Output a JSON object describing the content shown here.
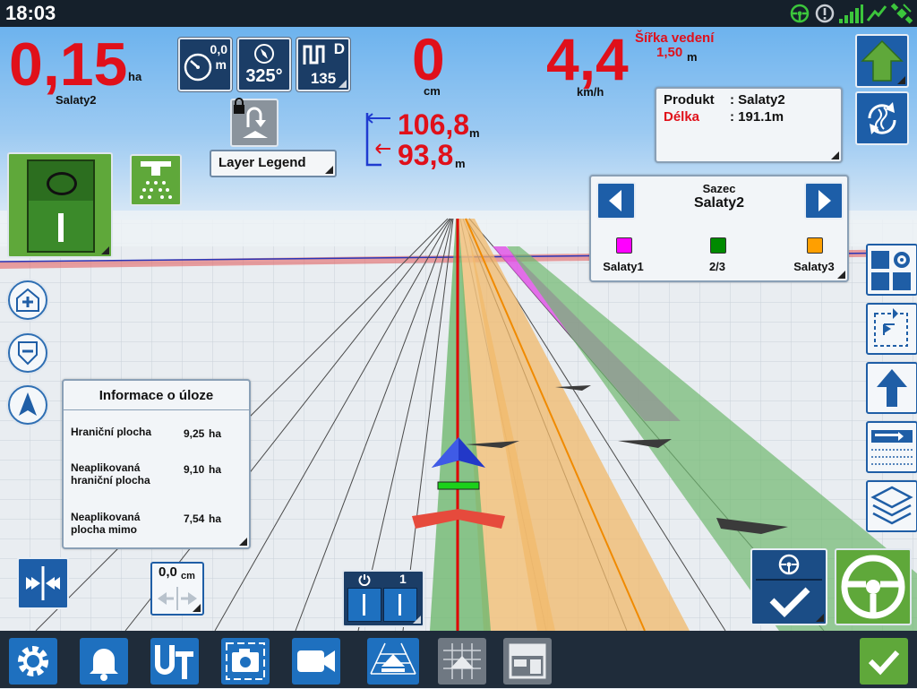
{
  "status": {
    "time": "18:03"
  },
  "area": {
    "value": "0,15",
    "unit": "ha",
    "product": "Salaty2"
  },
  "speedometer_tile": {
    "value": "0,0",
    "unit": "m"
  },
  "heading_tile": {
    "value": "325°"
  },
  "pattern_tile": {
    "letter": "D",
    "value": "135"
  },
  "layer_legend": {
    "label": "Layer Legend"
  },
  "offset": {
    "value": "0",
    "unit": "cm"
  },
  "distances": {
    "top_value": "106,8",
    "top_unit": "m",
    "bottom_value": "93,8",
    "bottom_unit": "m"
  },
  "speed": {
    "value": "4,4",
    "unit": "km/h"
  },
  "guidance_width": {
    "label": "Šířka vedení",
    "value": "1,50",
    "unit": "m"
  },
  "product_panel": {
    "product_label": "Produkt",
    "product_value": ": Salaty2",
    "length_label": "Délka",
    "length_value": ": 191.1m"
  },
  "seeder_panel": {
    "title": "Sazec",
    "selected": "Salaty2",
    "items": [
      {
        "label": "Salaty1",
        "color": "#ff00ff"
      },
      {
        "label": "2/3",
        "color": "#008a00"
      },
      {
        "label": "Salaty3",
        "color": "#ff9f00"
      }
    ]
  },
  "task_info": {
    "title": "Informace o úloze",
    "rows": [
      {
        "label": "Hraniční plocha",
        "value": "9,25",
        "unit": "ha"
      },
      {
        "label": "Neaplikovaná hraniční plocha",
        "value": "9,10",
        "unit": "ha"
      },
      {
        "label": "Neaplikovaná plocha mimo",
        "value": "7,54",
        "unit": "ha"
      }
    ]
  },
  "nudge": {
    "value": "0,0",
    "unit": "cm"
  },
  "sections": {
    "count": "1"
  },
  "colors": {
    "red_value": "#e0101a",
    "accent_blue": "#1e70bf",
    "green_button": "#5fa83a"
  }
}
